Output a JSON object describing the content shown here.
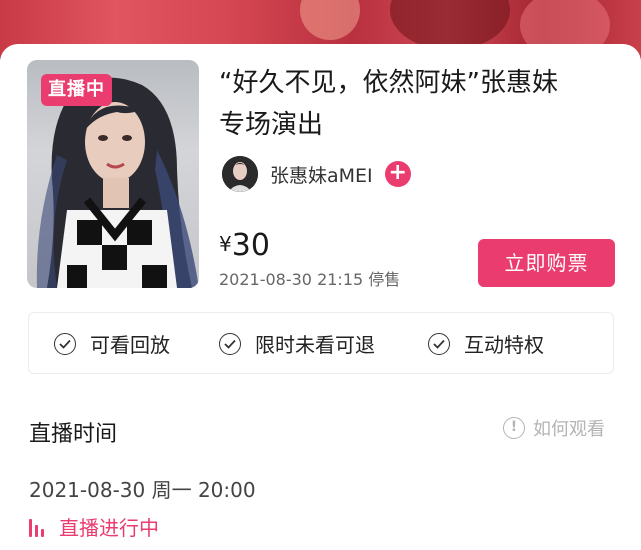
{
  "event": {
    "live_tag": "直播中",
    "title_line1": "“好久不见，依然阿妹”张惠妹",
    "title_line2": "专场演出",
    "artist_name": "张惠妹aMEI",
    "follow_icon": "plus-icon",
    "currency": "¥",
    "price": "30",
    "deadline": "2021-08-30 21:15 停售",
    "buy_label": "立即购票"
  },
  "perks": [
    {
      "icon": "check-circle-icon",
      "label": "可看回放"
    },
    {
      "icon": "check-circle-icon",
      "label": "限时未看可退"
    },
    {
      "icon": "check-circle-icon",
      "label": "互动特权"
    }
  ],
  "schedule": {
    "section_title": "直播时间",
    "howto_label": "如何观看",
    "howto_icon": "exclamation-circle-icon",
    "time": "2021-08-30 周一 20:00",
    "status": "直播进行中",
    "status_icon": "live-bars-icon"
  },
  "colors": {
    "accent": "#ea3c6e",
    "muted": "#b4b4b4"
  }
}
